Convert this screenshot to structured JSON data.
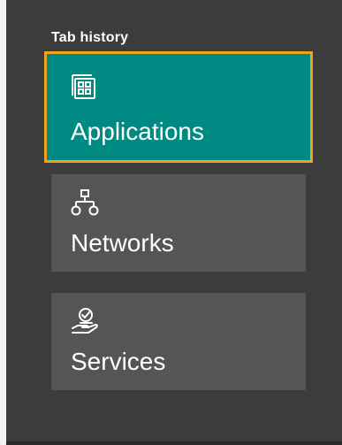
{
  "panel": {
    "title": "Tab history",
    "tabs": [
      {
        "label": "Applications",
        "icon": "applications-icon",
        "selected": true
      },
      {
        "label": "Networks",
        "icon": "network-icon",
        "selected": false
      },
      {
        "label": "Services",
        "icon": "services-icon",
        "selected": false
      }
    ]
  },
  "colors": {
    "panel_bg": "#3c3c3c",
    "tile_bg": "#555555",
    "selected_bg": "#008a84",
    "focus_border": "#f0a21c",
    "text": "#ffffff"
  }
}
